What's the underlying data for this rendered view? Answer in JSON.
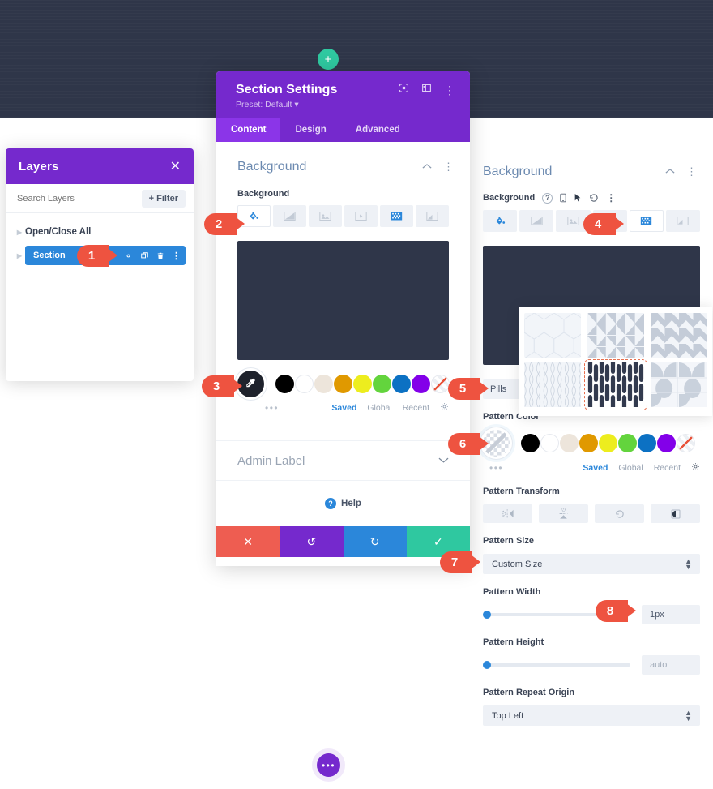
{
  "canvas": {
    "add_button_icon": "plus-icon",
    "fab_icon": "ellipsis-icon",
    "dark_section_color": "#2f3649"
  },
  "layers_panel": {
    "title": "Layers",
    "close_icon": "close-icon",
    "search_placeholder": "Search Layers",
    "filter_label": "+ Filter",
    "items": [
      {
        "label": "Open/Close All"
      },
      {
        "label": "Section"
      }
    ],
    "row_icons": [
      "gear-icon",
      "duplicate-icon",
      "trash-icon",
      "ellipsis-vertical-icon"
    ]
  },
  "settings_modal": {
    "title": "Section Settings",
    "preset": "Preset: Default",
    "header_icons": [
      "expand-icon",
      "layout-icon",
      "ellipsis-vertical-icon"
    ],
    "tabs": [
      {
        "label": "Content",
        "active": true
      },
      {
        "label": "Design",
        "active": false
      },
      {
        "label": "Advanced",
        "active": false
      }
    ],
    "background_toggle": {
      "title": "Background",
      "collapse_icon": "chevron-up-icon",
      "menu_icon": "ellipsis-vertical-icon"
    },
    "background_field_label": "Background",
    "background_types": [
      {
        "name": "color-fill-icon",
        "active": true
      },
      {
        "name": "gradient-icon",
        "active": false
      },
      {
        "name": "image-icon",
        "active": false
      },
      {
        "name": "video-icon",
        "active": false
      },
      {
        "name": "pattern-icon",
        "active": false
      },
      {
        "name": "mask-icon",
        "active": false
      }
    ],
    "preview_color": "#2f3649",
    "picker_icon": "eyedropper-icon",
    "swatches": [
      "#000000",
      "#ffffff",
      "#edE5DB",
      "#e09900",
      "#eded1e",
      "#63d43d",
      "#0c71c3",
      "#8300e9",
      "transparent"
    ],
    "dots_icon": "ellipsis-icon",
    "color_meta": [
      {
        "label": "Saved",
        "active": true
      },
      {
        "label": "Global",
        "active": false
      },
      {
        "label": "Recent",
        "active": false
      }
    ],
    "color_settings_icon": "gear-icon",
    "admin_label": "Admin Label",
    "admin_label_chevron": "chevron-down-icon",
    "help_label": "Help",
    "help_icon": "question-icon",
    "actions": [
      {
        "name": "cancel-button",
        "icon": "close-icon",
        "color": "#ee5d51"
      },
      {
        "name": "undo-button",
        "icon": "undo-icon",
        "color": "#7529cd"
      },
      {
        "name": "redo-button",
        "icon": "redo-icon",
        "color": "#2b87da"
      },
      {
        "name": "save-button",
        "icon": "check-icon",
        "color": "#2fc8a0"
      }
    ]
  },
  "right_panel": {
    "background_toggle": {
      "title": "Background",
      "collapse_icon": "chevron-up-icon",
      "menu_icon": "ellipsis-vertical-icon"
    },
    "background_field_label": "Background",
    "field_icons": [
      "question-icon",
      "mobile-icon",
      "cursor-icon",
      "reset-icon",
      "ellipsis-vertical-icon"
    ],
    "background_types": [
      {
        "name": "color-fill-icon",
        "active": false
      },
      {
        "name": "gradient-icon",
        "active": false
      },
      {
        "name": "image-icon",
        "active": false
      },
      {
        "name": "pattern-icon",
        "active": true
      },
      {
        "name": "mask-icon",
        "active": false
      }
    ],
    "preview_color": "#2f3649",
    "pattern_name": "Pills",
    "pattern_grid": [
      {
        "name": "hexagons-pattern",
        "selected": false
      },
      {
        "name": "triangles-pattern",
        "selected": false
      },
      {
        "name": "chevron-pattern",
        "selected": false
      },
      {
        "name": "moroccan-pattern",
        "selected": false
      },
      {
        "name": "pills-pattern",
        "selected": true
      },
      {
        "name": "circles-pattern",
        "selected": false
      }
    ],
    "pattern_color_label": "Pattern Color",
    "pattern_color_current": "transparent-checker",
    "swatches": [
      "#000000",
      "#ffffff",
      "#edE5DB",
      "#e09900",
      "#eded1e",
      "#63d43d",
      "#0c71c3",
      "#8300e9",
      "transparent"
    ],
    "dots_icon": "ellipsis-icon",
    "color_meta": [
      {
        "label": "Saved",
        "active": true
      },
      {
        "label": "Global",
        "active": false
      },
      {
        "label": "Recent",
        "active": false
      }
    ],
    "color_settings_icon": "gear-icon",
    "pattern_transform_label": "Pattern Transform",
    "transform_buttons": [
      "flip-horizontal-icon",
      "flip-vertical-icon",
      "rotate-icon",
      "invert-icon"
    ],
    "pattern_size_label": "Pattern Size",
    "pattern_size_value": "Custom Size",
    "pattern_width_label": "Pattern Width",
    "pattern_width_value": "1px",
    "pattern_height_label": "Pattern Height",
    "pattern_height_value": "auto",
    "pattern_repeat_origin_label": "Pattern Repeat Origin",
    "pattern_repeat_origin_value": "Top Left"
  },
  "badges": [
    {
      "number": "1"
    },
    {
      "number": "2"
    },
    {
      "number": "3"
    },
    {
      "number": "4"
    },
    {
      "number": "5"
    },
    {
      "number": "6"
    },
    {
      "number": "7"
    },
    {
      "number": "8"
    }
  ]
}
